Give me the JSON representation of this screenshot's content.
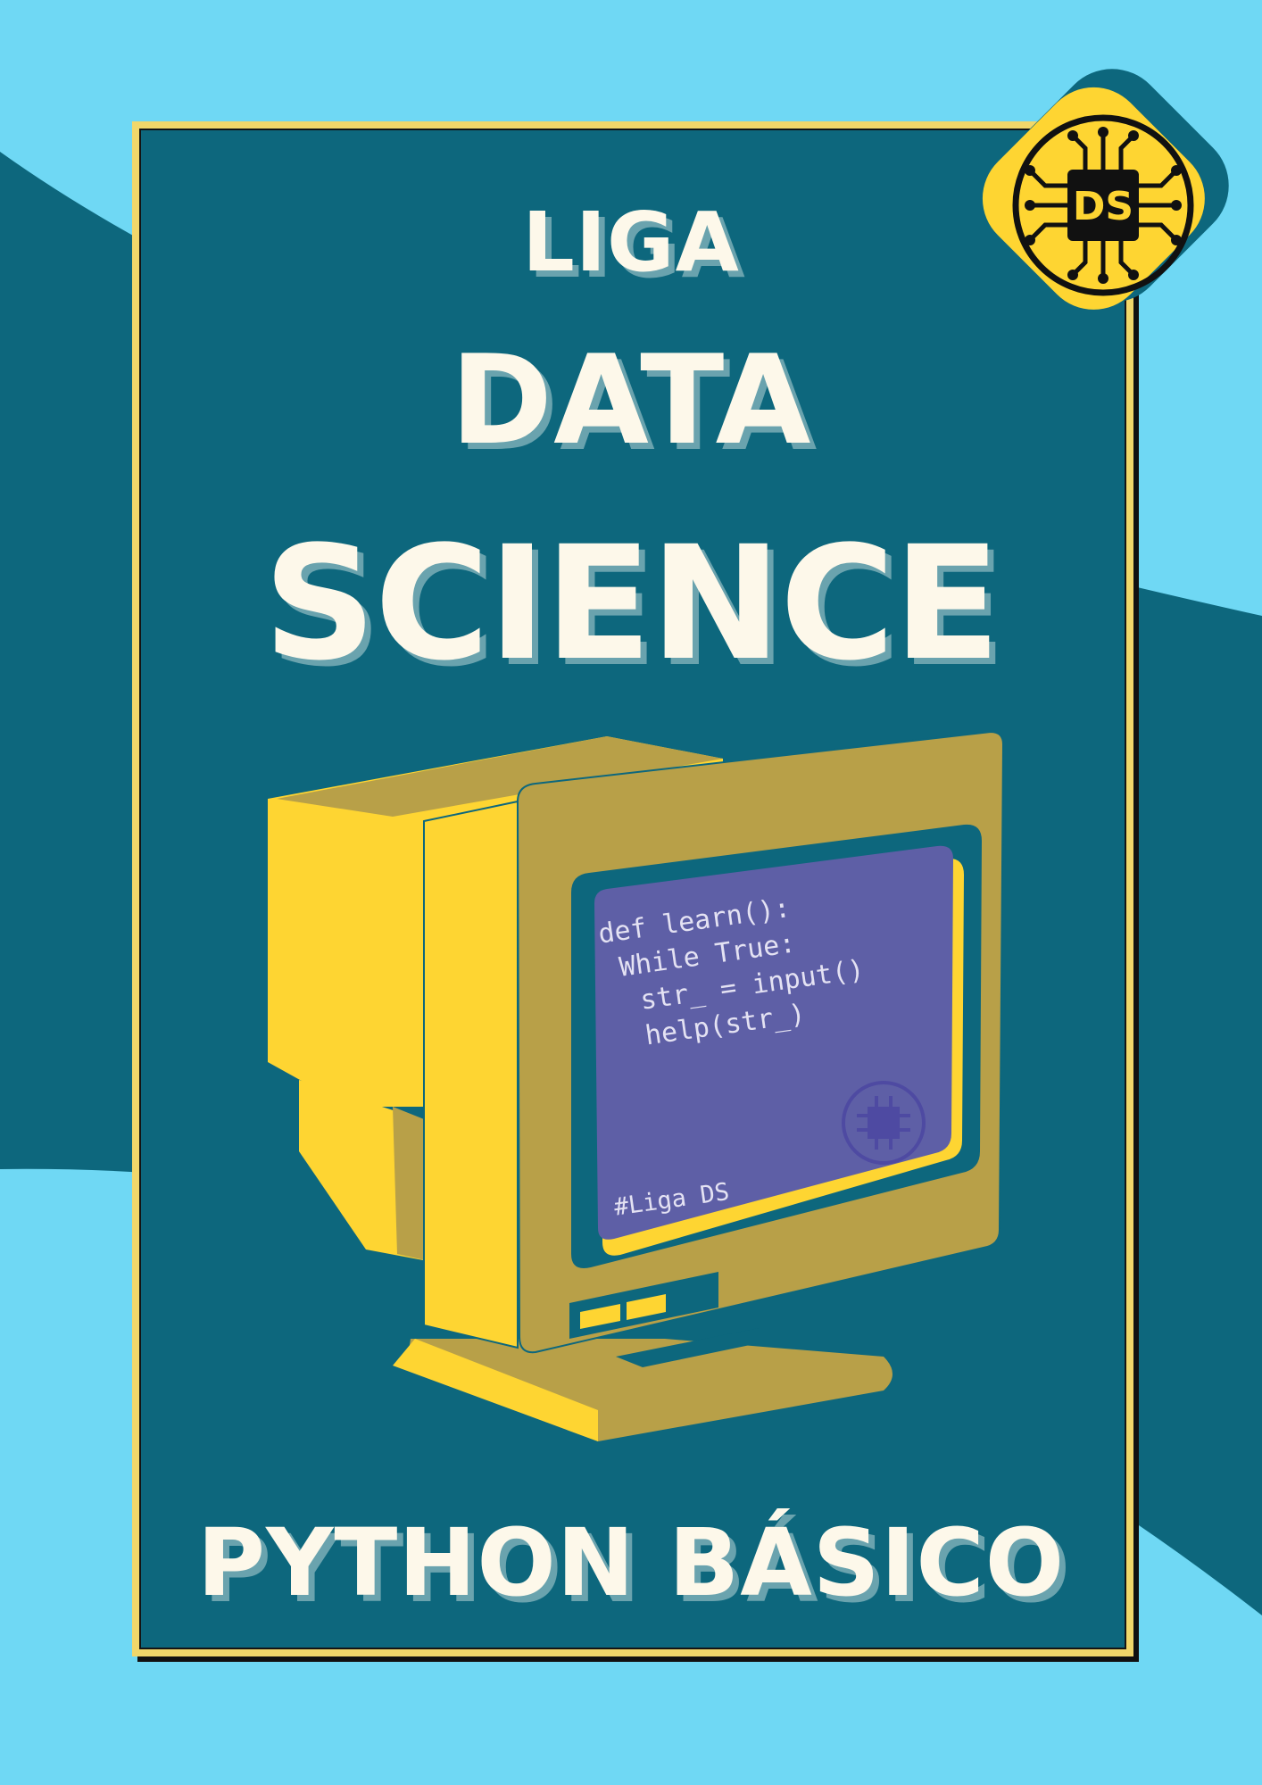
{
  "colors": {
    "sky": "#6fd8f4",
    "teal": "#0d677d",
    "yellow": "#fed532",
    "mustard": "#b8a048",
    "screen": "#5e5fa6",
    "cream": "#fdf8ea"
  },
  "title": {
    "line1": "LIGA",
    "line2": "DATA",
    "line3": "SCIENCE"
  },
  "subtitle": "PYTHON BÁSICO",
  "badge": {
    "label": "DS",
    "icon": "chip-circuit-icon"
  },
  "screen": {
    "code_lines": [
      "def learn():",
      " While True:",
      "  str_ = input()",
      "  help(str_)"
    ],
    "tag": "#Liga DS",
    "watermark_icon": "chip-circuit-icon"
  }
}
